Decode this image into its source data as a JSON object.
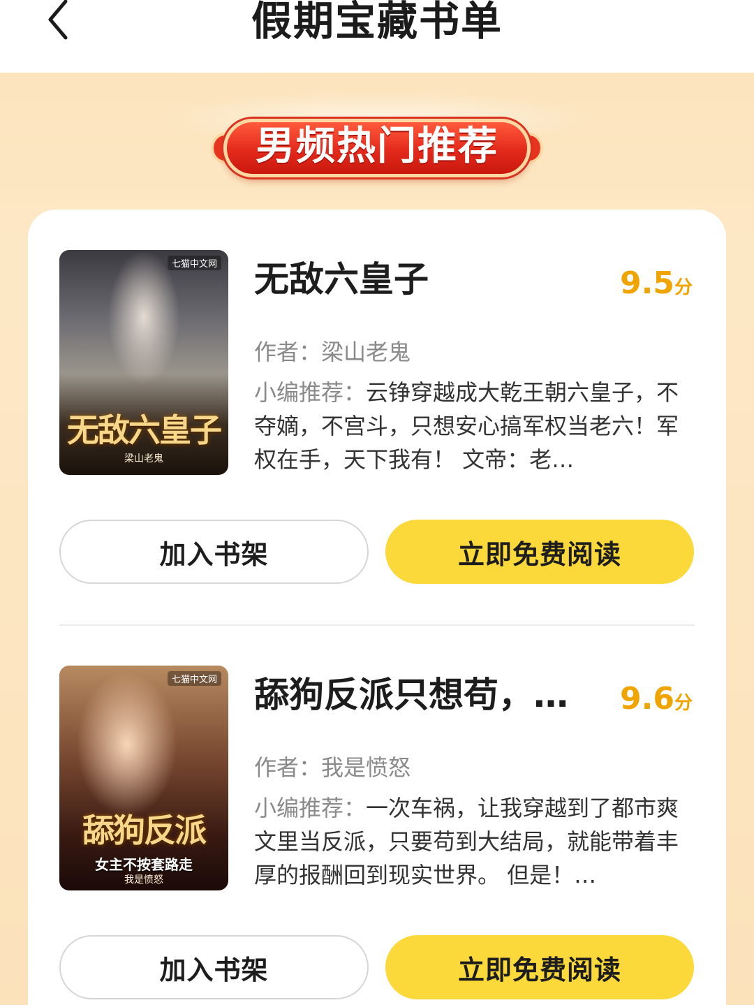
{
  "header": {
    "title": "假期宝藏书单",
    "back_icon": "chevron-left-icon"
  },
  "section": {
    "banner_label": "男频热门推荐"
  },
  "books": [
    {
      "title": "无敌六皇子",
      "score": "9.5",
      "score_unit": "分",
      "author_label": "作者：",
      "author": "梁山老鬼",
      "desc_label": "小编推荐：",
      "desc": "云铮穿越成大乾王朝六皇子，不夺嫡，不宫斗，只想安心搞军权当老六！军权在手，天下我有！ 文帝：老…",
      "cover_brand": "七猫中文网",
      "cover_title": "无敌六皇子",
      "cover_author": "梁山老鬼",
      "shelf_button": "加入书架",
      "read_button": "立即免费阅读"
    },
    {
      "title": "舔狗反派只想苟，…",
      "score": "9.6",
      "score_unit": "分",
      "author_label": "作者：",
      "author": "我是愤怒",
      "desc_label": "小编推荐：",
      "desc": "一次车祸，让我穿越到了都市爽文里当反派，只要苟到大结局，就能带着丰厚的报酬回到现实世界。 但是！…",
      "cover_brand": "七猫中文网",
      "cover_title": "舔狗反派",
      "cover_tagline": "女主不按套路走",
      "cover_author": "我是愤怒",
      "shelf_button": "加入书架",
      "read_button": "立即免费阅读"
    }
  ]
}
